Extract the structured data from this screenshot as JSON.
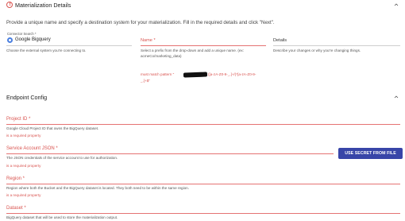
{
  "materialization": {
    "title": "Materialization Details",
    "intro": "Provide a unique name and specify a destination system for your materialization. Fill in the required details and click \"Next\".",
    "connector_search_label": "Connector Search *",
    "connector_value": "Google Bigquery",
    "connector_help": "Choose the external system you're connecting to.",
    "name_label": "Name *",
    "name_help_1": "Select a prefix from the drop-down and add a unique name. (ex:",
    "name_help_2": "acmeCo/marketing_data)",
    "pattern_prefix": "must match pattern \"",
    "pattern_suffix": "([a-zA-Z0-9-_.]+/)*[a-zA-Z0-9-",
    "pattern_line2": "_.]+$\"",
    "details_label": "Details",
    "details_help": "Describe your changes or why you're changing things."
  },
  "endpoint": {
    "title": "Endpoint Config",
    "project_label": "Project ID *",
    "project_desc": "Google Cloud Project ID that owns the BigQuery dataset.",
    "project_err": "is a required property",
    "sa_label": "Service Account JSON *",
    "sa_desc": "The JSON credentials of the service account to use for authorization.",
    "sa_err": "is a required property",
    "secret_button": "USE SECRET FROM FILE",
    "region_label": "Region *",
    "region_desc": "Region where both the Bucket and the BigQuery dataset is located. They both need to be within the same region.",
    "region_err": "is a required property",
    "dataset_label": "Dataset *",
    "dataset_desc": "BigQuery dataset that will be used to store the materialization output."
  },
  "icons": {
    "error": "alert-circle-icon",
    "collapse": "chevron-up-icon",
    "connector": "bigquery-icon"
  },
  "colors": {
    "error": "#d9534f",
    "button": "#3845a8"
  }
}
